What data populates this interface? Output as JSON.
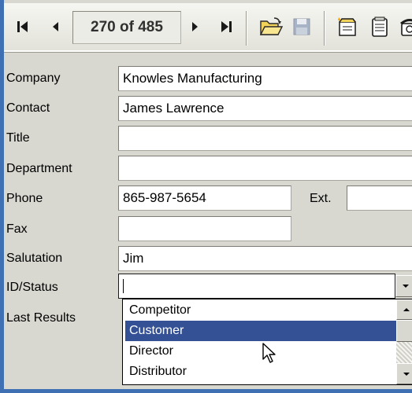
{
  "navigator": {
    "record_position": "270 of 485"
  },
  "form": {
    "company_label": "Company",
    "company_value": "Knowles Manufacturing",
    "contact_label": "Contact",
    "contact_value": "James Lawrence",
    "title_label": "Title",
    "title_value": "",
    "department_label": "Department",
    "department_value": "",
    "phone_label": "Phone",
    "phone_value": "865-987-5654",
    "ext_label": "Ext.",
    "ext_value": "",
    "fax_label": "Fax",
    "fax_value": "",
    "salutation_label": "Salutation",
    "salutation_value": "Jim",
    "id_status_label": "ID/Status",
    "id_status_value": "",
    "last_results_label": "Last Results"
  },
  "dropdown": {
    "options": [
      "Competitor",
      "Customer",
      "Director",
      "Distributor"
    ],
    "selected": "Customer"
  },
  "colors": {
    "selection": "#345196",
    "window_border": "#3f70b4",
    "form_background": "#d8d8d0"
  },
  "icons": [
    "first-record-icon",
    "previous-record-icon",
    "next-record-icon",
    "last-record-icon",
    "open-folder-icon",
    "save-disk-icon",
    "new-note-icon",
    "notepad-icon",
    "phone-icon",
    "mouse-pointer-icon"
  ]
}
